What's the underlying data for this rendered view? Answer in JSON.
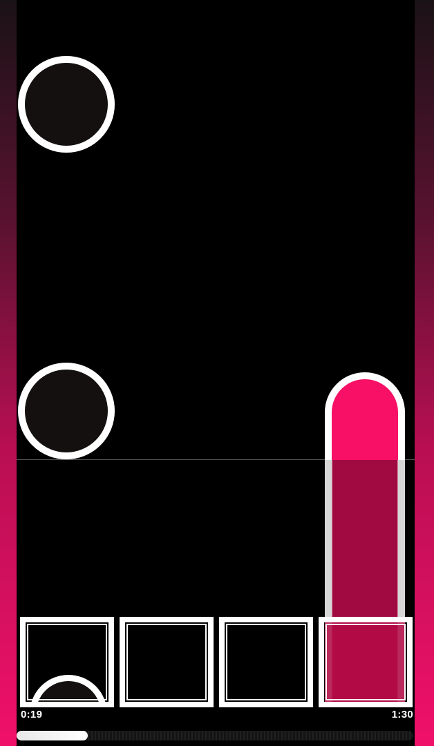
{
  "colors": {
    "accent": "#f71065",
    "background": "#000000",
    "note_fill": "#141010",
    "note_border": "#ffffff"
  },
  "playback": {
    "elapsed": "0:19",
    "total": "1:30",
    "progress": 0.18
  },
  "lanes": [
    {
      "lane": 1,
      "icon": "circle-note-icon"
    },
    {
      "lane": 2,
      "icon": "empty"
    },
    {
      "lane": 3,
      "icon": "empty"
    },
    {
      "lane": 4,
      "icon": "hold-note-icon"
    }
  ]
}
